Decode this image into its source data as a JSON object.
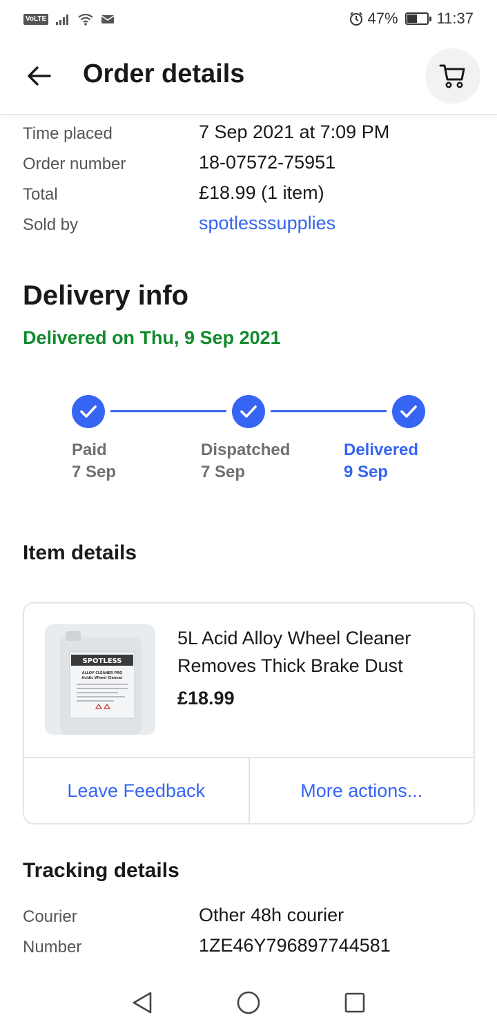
{
  "status_bar": {
    "network_badge": "VoLTE",
    "alarm_icon": "alarm-icon",
    "battery_percent": "47%",
    "battery_level": 0.47,
    "time": "11:37"
  },
  "header": {
    "title": "Order details",
    "back_icon": "arrow-left-icon",
    "cart_icon": "cart-icon"
  },
  "order_info": {
    "rows": [
      {
        "label": "Time placed",
        "value": "7 Sep 2021 at 7:09 PM"
      },
      {
        "label": "Order number",
        "value": "18-07572-75951"
      },
      {
        "label": "Total",
        "value": "£18.99 (1 item)"
      },
      {
        "label": "Sold by",
        "value": "spotlesssupplies"
      }
    ]
  },
  "delivery": {
    "heading": "Delivery info",
    "status": "Delivered on Thu, 9 Sep 2021",
    "steps": [
      {
        "name": "Paid",
        "date": "7 Sep"
      },
      {
        "name": "Dispatched",
        "date": "7 Sep"
      },
      {
        "name": "Delivered",
        "date": "9 Sep"
      }
    ]
  },
  "item_details": {
    "heading": "Item details",
    "item": {
      "title": "5L Acid Alloy Wheel Cleaner Removes Thick Brake Dust",
      "price": "£18.99",
      "image_brand": "SPOTLESS",
      "image_line1": "ALLOY CLEANER PRO",
      "image_line2": "Acidic Wheel Cleaner"
    },
    "actions": {
      "feedback": "Leave Feedback",
      "more": "More actions..."
    }
  },
  "tracking": {
    "heading": "Tracking details",
    "rows": [
      {
        "label": "Courier",
        "value": "Other 48h courier"
      },
      {
        "label": "Number",
        "value": "1ZE46Y796897744581"
      }
    ]
  },
  "colors": {
    "link_blue": "#3665f3",
    "success_green": "#118a2d",
    "text_primary": "#191919",
    "text_secondary": "#555555"
  }
}
